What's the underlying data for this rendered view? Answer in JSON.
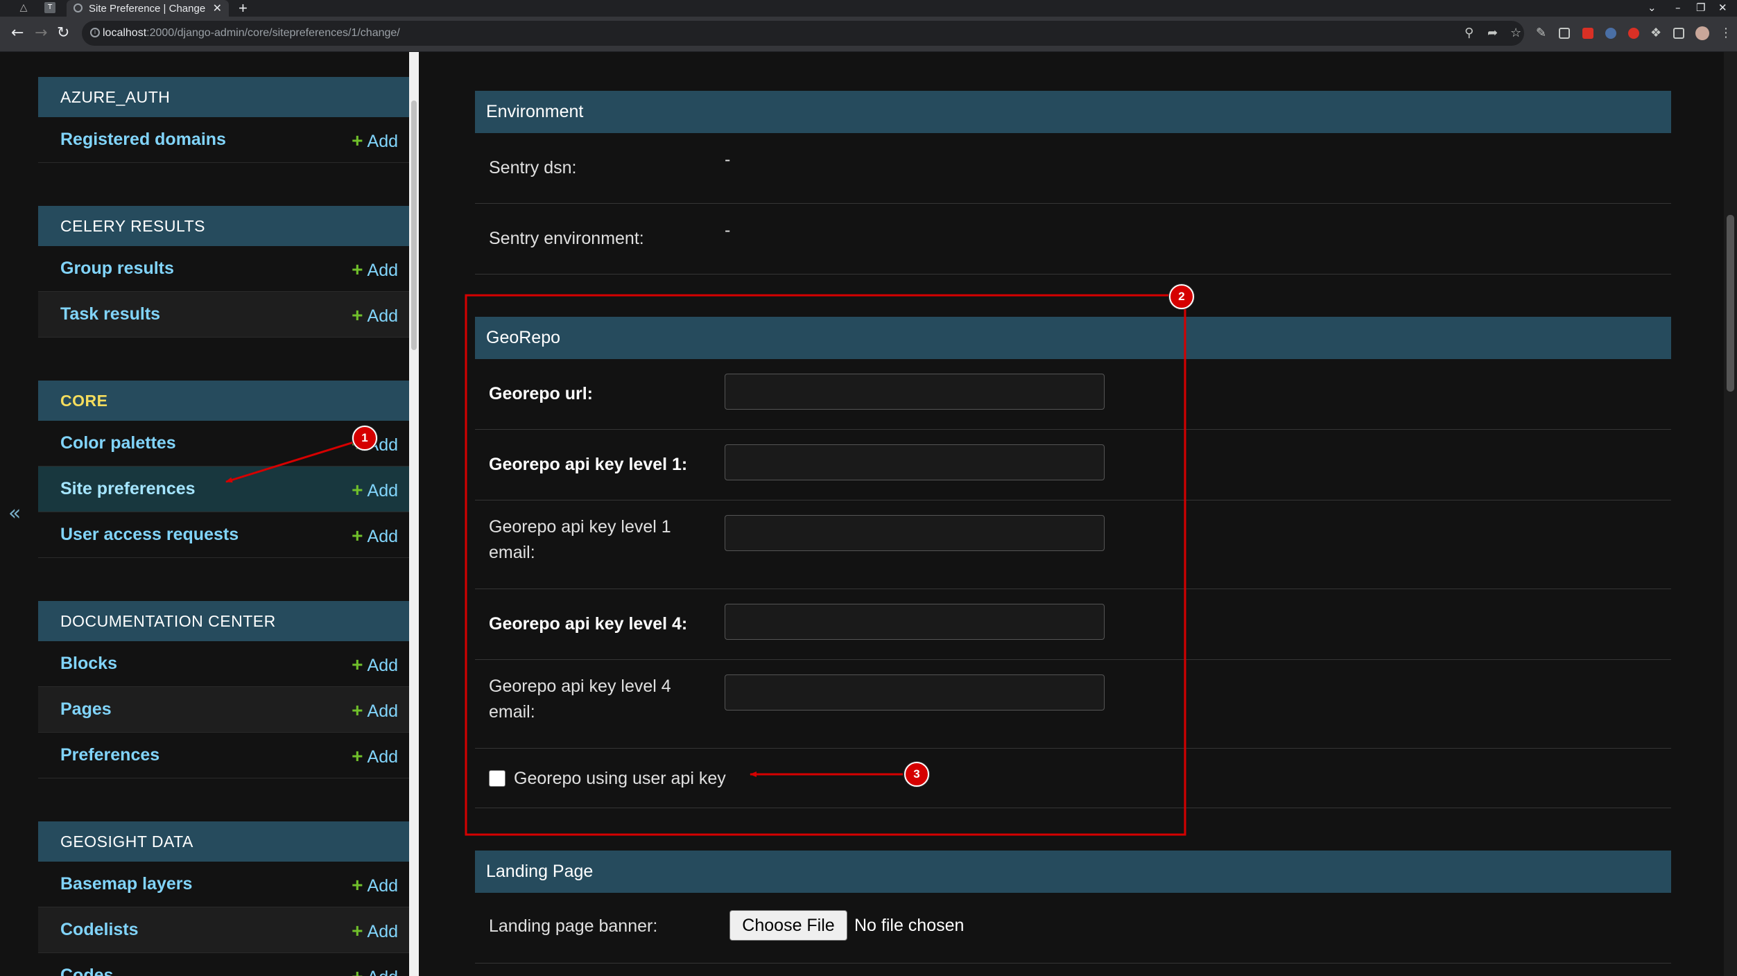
{
  "browser": {
    "tab_title": "Site Preference | Change",
    "url_host": "localhost",
    "url_path": ":2000/django-admin/core/sitepreferences/1/change/"
  },
  "sidebar": {
    "toggle_icon": "double-chevron-left-icon",
    "add_label": "Add",
    "modules": [
      {
        "caption": "AZURE_AUTH",
        "items": [
          {
            "label": "Registered domains"
          }
        ]
      },
      {
        "caption": "CELERY RESULTS",
        "items": [
          {
            "label": "Group results"
          },
          {
            "label": "Task results"
          }
        ]
      },
      {
        "caption": "CORE",
        "items": [
          {
            "label": "Color palettes"
          },
          {
            "label": "Site preferences"
          },
          {
            "label": "User access requests"
          }
        ]
      },
      {
        "caption": "DOCUMENTATION CENTER",
        "items": [
          {
            "label": "Blocks"
          },
          {
            "label": "Pages"
          },
          {
            "label": "Preferences"
          }
        ]
      },
      {
        "caption": "GEOSIGHT DATA",
        "items": [
          {
            "label": "Basemap layers"
          },
          {
            "label": "Codelists"
          },
          {
            "label": "Codes"
          }
        ]
      }
    ]
  },
  "form": {
    "environment": {
      "caption": "Environment",
      "sentry_dsn_label": "Sentry dsn:",
      "sentry_dsn_value": "-",
      "sentry_env_label": "Sentry environment:",
      "sentry_env_value": "-"
    },
    "georepo": {
      "caption": "GeoRepo",
      "url_label": "Georepo url:",
      "key1_label": "Georepo api key level 1:",
      "key1_email_label": "Georepo api key level 1 email:",
      "key4_label": "Georepo api key level 4:",
      "key4_email_label": "Georepo api key level 4 email:",
      "user_key_label": "Georepo using user api key",
      "user_key_checked": false
    },
    "landing": {
      "caption": "Landing Page",
      "banner_label": "Landing page banner:",
      "choose_file": "Choose File",
      "no_file": "No file chosen"
    }
  },
  "annotations": {
    "badge_1": "1",
    "badge_2": "2",
    "badge_3": "3",
    "color": "#d50000"
  }
}
